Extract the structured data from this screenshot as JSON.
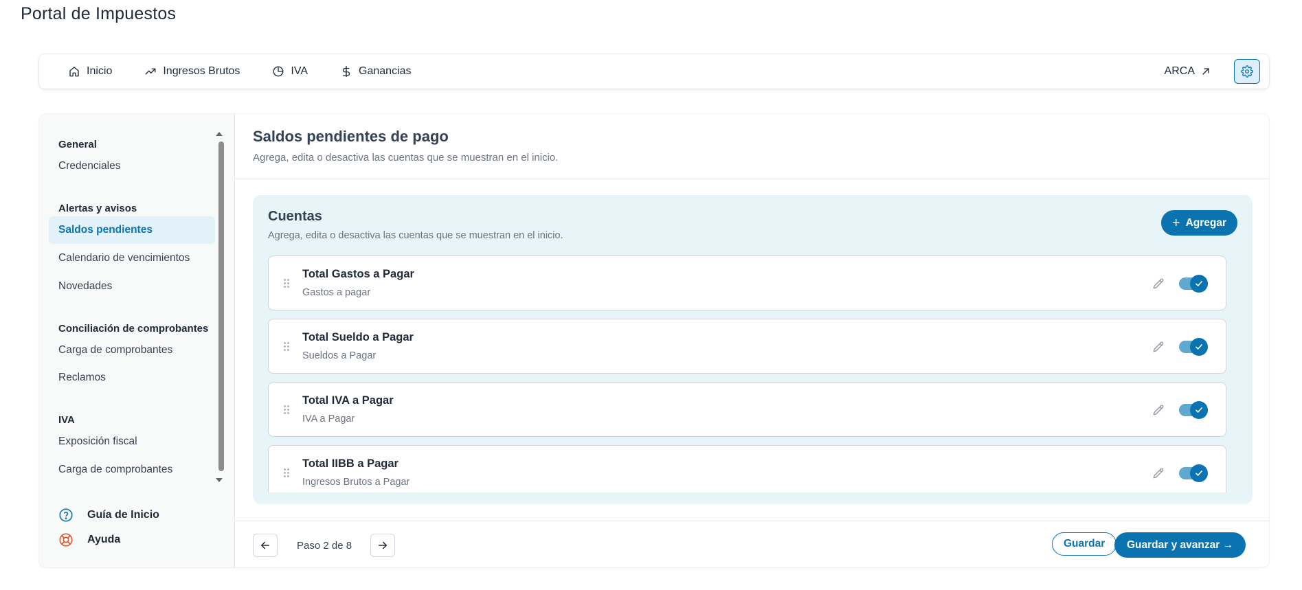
{
  "app": {
    "title": "Portal de Impuestos"
  },
  "topnav": {
    "items": [
      {
        "label": "Inicio",
        "icon": "home-icon"
      },
      {
        "label": "Ingresos Brutos",
        "icon": "trending-up-icon"
      },
      {
        "label": "IVA",
        "icon": "pie-chart-icon"
      },
      {
        "label": "Ganancias",
        "icon": "dollar-icon"
      }
    ],
    "external_link": {
      "label": "ARCA",
      "icon": "arrow-up-right-icon"
    },
    "settings_icon": "gear-icon"
  },
  "sidebar": {
    "groups": [
      {
        "label": "General",
        "items": [
          "Credenciales"
        ]
      },
      {
        "label": "Alertas y avisos",
        "items": [
          "Saldos pendientes",
          "Calendario de vencimientos",
          "Novedades"
        ]
      },
      {
        "label": "Conciliación de comprobantes",
        "items": [
          "Carga de comprobantes",
          "Reclamos"
        ]
      },
      {
        "label": "IVA",
        "items": [
          "Exposición fiscal",
          "Carga de comprobantes"
        ]
      }
    ],
    "active_item": "Saldos pendientes",
    "footer": [
      {
        "label": "Guía de Inicio",
        "icon": "help-circle-icon"
      },
      {
        "label": "Ayuda",
        "icon": "lifebuoy-icon"
      }
    ]
  },
  "content": {
    "title": "Saldos pendientes de pago",
    "subtitle": "Agrega, edita o desactiva las cuentas que se muestran en el inicio.",
    "cuentas": {
      "title": "Cuentas",
      "subtitle": "Agrega, edita o desactiva las cuentas que se muestran en el inicio.",
      "add_label": "Agregar",
      "accounts": [
        {
          "name": "Total Gastos a Pagar",
          "description": "Gastos a pagar",
          "enabled": true
        },
        {
          "name": "Total Sueldo a Pagar",
          "description": "Sueldos a Pagar",
          "enabled": true
        },
        {
          "name": "Total IVA a Pagar",
          "description": "IVA a Pagar",
          "enabled": true
        },
        {
          "name": "Total IIBB a Pagar",
          "description": "Ingresos Brutos a Pagar",
          "enabled": true
        }
      ]
    },
    "footer": {
      "step_label": "Paso 2 de 8",
      "save_label": "Guardar",
      "save_next_label": "Guardar y avanzar →"
    }
  },
  "colors": {
    "accent": "#0b74b0",
    "accent_light": "#e7f4f8",
    "active_bg": "#e3f1f8"
  }
}
